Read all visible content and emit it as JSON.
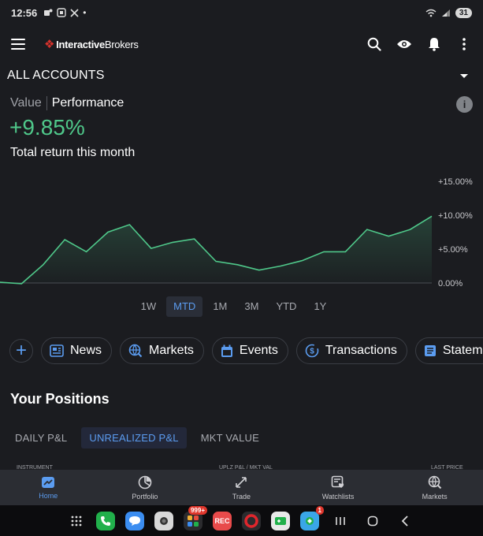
{
  "status": {
    "time": "12:56",
    "battery": "31"
  },
  "app": {
    "brand_bold": "Interactive",
    "brand_light": "Brokers"
  },
  "accounts": {
    "label": "ALL ACCOUNTS"
  },
  "summary": {
    "value_tab": "Value",
    "performance_tab": "Performance",
    "return_value": "+9.85%",
    "return_label": "Total return this month"
  },
  "chart_data": {
    "type": "area",
    "x": [
      0,
      1,
      2,
      3,
      4,
      5,
      6,
      7,
      8,
      9,
      10,
      11,
      12,
      13,
      14,
      15,
      16,
      17,
      18,
      19,
      20
    ],
    "y": [
      0.1,
      -0.1,
      2.7,
      6.4,
      4.6,
      7.5,
      8.6,
      5.1,
      6.0,
      6.5,
      3.2,
      2.7,
      1.9,
      2.5,
      3.3,
      4.6,
      4.6,
      7.9,
      6.9,
      7.9,
      9.85
    ],
    "ylim": [
      0,
      15
    ],
    "yticks": [
      "+15.00%",
      "+10.00%",
      "+5.00%",
      "0.00%"
    ],
    "line_color": "#4fc88a",
    "grid": false
  },
  "timeframes": [
    "1W",
    "MTD",
    "1M",
    "3M",
    "YTD",
    "1Y"
  ],
  "timeframe_active": "MTD",
  "pills": [
    "News",
    "Markets",
    "Events",
    "Transactions",
    "Statemen"
  ],
  "positions": {
    "title": "Your Positions",
    "tabs": [
      "DAILY P&L",
      "UNREALIZED P&L",
      "MKT VALUE"
    ],
    "active_tab": "UNREALIZED P&L",
    "columns": [
      "INSTRUMENT",
      "UPLZ P&L / MKT VAL",
      "LAST PRICE"
    ]
  },
  "bottom_nav": [
    "Home",
    "Portfolio",
    "Trade",
    "Watchlists",
    "Markets"
  ],
  "system": {
    "badge_apps": "999+",
    "rec_label": "REC",
    "badge_count": "1"
  },
  "colors": {
    "accent": "#5b9cf0",
    "positive": "#4fc88a",
    "background": "#1b1c20"
  }
}
